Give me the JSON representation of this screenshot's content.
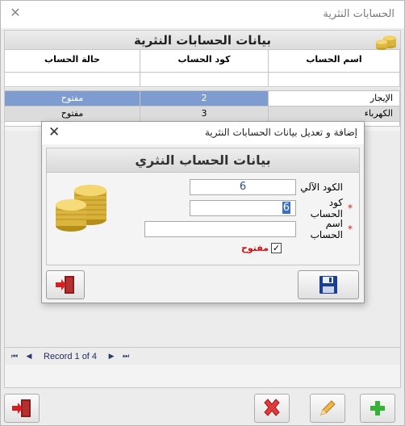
{
  "window": {
    "title": "الحسابات النثرية"
  },
  "panel": {
    "title": "بيانات الحسابات النثرية"
  },
  "grid": {
    "columns": [
      "اسم الحساب",
      "كود الحساب",
      "حالة الحساب"
    ],
    "rows": [
      {
        "name": "الإيجار",
        "code": "2",
        "state": "مفتوح"
      },
      {
        "name": "الكهرباء",
        "code": "3",
        "state": "مفتوح"
      }
    ]
  },
  "navigator": {
    "record_label": "Record 1 of 4"
  },
  "dialog": {
    "title": "إضافة و تعديل بيانات الحسابات النثرية",
    "header": "بيانات الحساب النثري",
    "fields": {
      "auto_code_label": "الكود الآلي",
      "auto_code_value": "6",
      "account_code_label": "كود الحساب",
      "account_code_value": "6",
      "account_name_label": "اسم الحساب",
      "account_name_value": "",
      "required_mark": "*"
    },
    "open_checkbox": {
      "label": "مفتوح",
      "checked": true
    }
  },
  "icons": {
    "exit": "exit-door-icon",
    "save": "floppy-disk-icon",
    "delete": "red-x-icon",
    "edit": "pencil-icon",
    "add": "green-plus-icon",
    "coins": "coins-stack-icon"
  },
  "colors": {
    "selected_row": "#7f9cd1",
    "required": "#d21b1b",
    "open_label": "#d01010"
  }
}
